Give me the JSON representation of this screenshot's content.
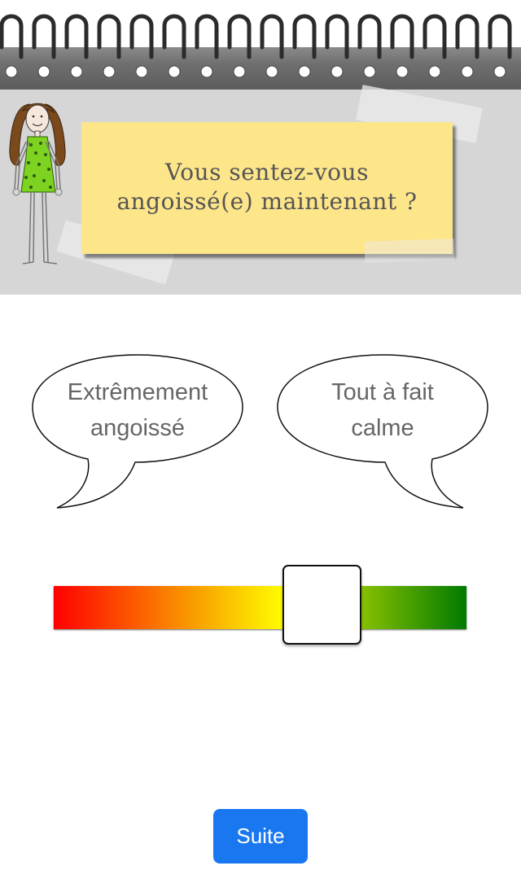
{
  "question": {
    "line1": "Vous sentez-vous",
    "line2": "angoissé(e) maintenant ?"
  },
  "scale": {
    "left_label_line1": "Extrêmement",
    "left_label_line2": "angoissé",
    "right_label_line1": "Tout à fait",
    "right_label_line2": "calme",
    "gradient_colors": [
      "#ff0000",
      "#f9a200",
      "#ffff00",
      "#7fbc00",
      "#007a00"
    ],
    "thumb_value_fraction": 0.65
  },
  "buttons": {
    "next_label": "Suite"
  },
  "colors": {
    "accent": "#1977f0",
    "note": "#fde58a",
    "header_background": "#d6d6d6"
  },
  "icons": {
    "binder": "spiral-binding",
    "character": "girl-illustration"
  }
}
